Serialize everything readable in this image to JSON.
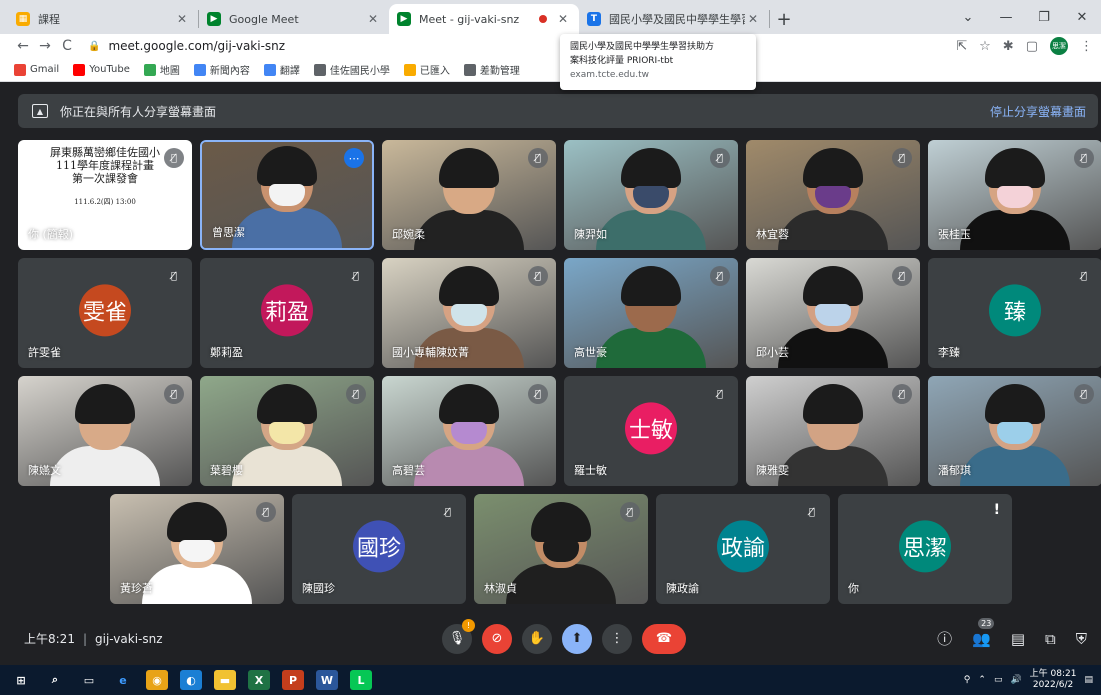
{
  "browser": {
    "tabs": [
      {
        "label": "課程",
        "fav_color": "#f9ab00",
        "fav_char": "▦"
      },
      {
        "label": "Google Meet",
        "fav_color": "#00832d",
        "fav_char": "▶"
      },
      {
        "label": "Meet - gij-vaki-snz",
        "fav_color": "#00832d",
        "fav_char": "▶",
        "active": true
      },
      {
        "label": "國民小學及國民中學學生學習扶...",
        "fav_color": "#1a73e8",
        "fav_char": "T"
      }
    ],
    "new_tab": "+",
    "url": "meet.google.com/gij-vaki-snz",
    "profile_initials": "思潔",
    "bookmarks": [
      {
        "label": "Gmail",
        "color": "#ea4335"
      },
      {
        "label": "YouTube",
        "color": "#ff0000"
      },
      {
        "label": "地圖",
        "color": "#34a853"
      },
      {
        "label": "新聞內容",
        "color": "#4285f4"
      },
      {
        "label": "翻譯",
        "color": "#4285f4"
      },
      {
        "label": "佳佐國民小學",
        "color": "#5f6368"
      },
      {
        "label": "已匯入",
        "color": "#f9ab00"
      },
      {
        "label": "差勤管理",
        "color": "#5f6368"
      }
    ],
    "tooltip": {
      "line1": "國民小學及國民中學學生學習扶助方",
      "line2": "案科技化評量 PRIORI-tbt",
      "domain": "exam.tcte.edu.tw"
    }
  },
  "meet": {
    "share_banner": "你正在與所有人分享螢幕畫面",
    "stop_share": "停止分享螢幕畫面",
    "slide": {
      "line1": "屏東縣萬巒鄉佳佐國小",
      "line2": "111學年度課程計畫",
      "line3": "第一次課發會",
      "line4": "111.6.2(四) 13:00"
    },
    "participants": [
      {
        "name": "你 (簡報)",
        "type": "slide"
      },
      {
        "name": "曾思潔",
        "type": "video",
        "bg": "#6b5a48",
        "skin": "#c9926f",
        "shirt": "#4a6fa5",
        "mask": "#f3f3f3",
        "self": true
      },
      {
        "name": "邱婉柔",
        "type": "video",
        "bg": "#c9b89a",
        "skin": "#d8a985",
        "shirt": "#222222"
      },
      {
        "name": "陳羿如",
        "type": "video",
        "bg": "#9bc0c4",
        "skin": "#d6a283",
        "shirt": "#3d6e6a",
        "mask": "#3a4b6a"
      },
      {
        "name": "林宜蓉",
        "type": "video",
        "bg": "#a08a6a",
        "skin": "#b7805e",
        "shirt": "#2b2b2b",
        "mask": "#6a3c8a"
      },
      {
        "name": "張桂玉",
        "type": "video",
        "bg": "#bfcfd4",
        "skin": "#d6a483",
        "shirt": "#111111",
        "mask": "#f4d2d8"
      },
      {
        "name": "許雯雀",
        "type": "avatar",
        "initials": "雯雀",
        "color": "#c5491f"
      },
      {
        "name": "鄭莉盈",
        "type": "avatar",
        "initials": "莉盈",
        "color": "#c2185b"
      },
      {
        "name": "國小專輔陳妏菁",
        "type": "video",
        "bg": "#d8d2c2",
        "skin": "#d6a283",
        "shirt": "#7a5a45",
        "mask": "#cfe3ea"
      },
      {
        "name": "高世豪",
        "type": "video",
        "bg": "#7aa7c8",
        "skin": "#9c6a4c",
        "shirt": "#1f6a3a"
      },
      {
        "name": "邱小芸",
        "type": "video",
        "bg": "#d9d9d4",
        "skin": "#d3a083",
        "shirt": "#111111",
        "mask": "#bcd3ea"
      },
      {
        "name": "李臻",
        "type": "avatar",
        "initials": "臻",
        "color": "#00897b"
      },
      {
        "name": "陳嬿文",
        "type": "video",
        "bg": "#d6d3cd",
        "skin": "#d8aa88",
        "shirt": "#eeeeee"
      },
      {
        "name": "葉碧櫻",
        "type": "video",
        "bg": "#8fa88a",
        "skin": "#d4a686",
        "shirt": "#e9e3d5",
        "mask": "#f3e6a8"
      },
      {
        "name": "高碧芸",
        "type": "video",
        "bg": "#c9d6d0",
        "skin": "#d6a583",
        "shirt": "#b88ab0",
        "mask": "#b58ad0"
      },
      {
        "name": "羅士敏",
        "type": "avatar",
        "initials": "士敏",
        "color": "#e91e63"
      },
      {
        "name": "陳雅雯",
        "type": "video",
        "bg": "#cfcfcf",
        "skin": "#d2a384",
        "shirt": "#333333"
      },
      {
        "name": "潘郁琪",
        "type": "video",
        "bg": "#8fa6b6",
        "skin": "#d3a384",
        "shirt": "#3a6c8a",
        "mask": "#9ccfea"
      },
      {
        "name": "黃珍蒼",
        "type": "video",
        "bg": "#c8bfb0",
        "skin": "#e0b491",
        "shirt": "#ffffff",
        "mask": "#f5f5f5"
      },
      {
        "name": "陳國珍",
        "type": "avatar",
        "initials": "國珍",
        "color": "#3f51b5"
      },
      {
        "name": "林淑貞",
        "type": "video",
        "bg": "#7b8f6e",
        "skin": "#c28c66",
        "shirt": "#1f1f1f",
        "mask": "#1c1c1c"
      },
      {
        "name": "陳政諭",
        "type": "avatar",
        "initials": "政諭",
        "color": "#00838f"
      },
      {
        "name": "你",
        "type": "avatar",
        "initials": "思潔",
        "color": "#00897b",
        "alert": true
      }
    ],
    "time": "上午8:21",
    "meeting_code": "gij-vaki-snz",
    "participant_count": "23"
  },
  "taskbar": {
    "time": "上午 08:21",
    "date": "2022/6/2"
  }
}
